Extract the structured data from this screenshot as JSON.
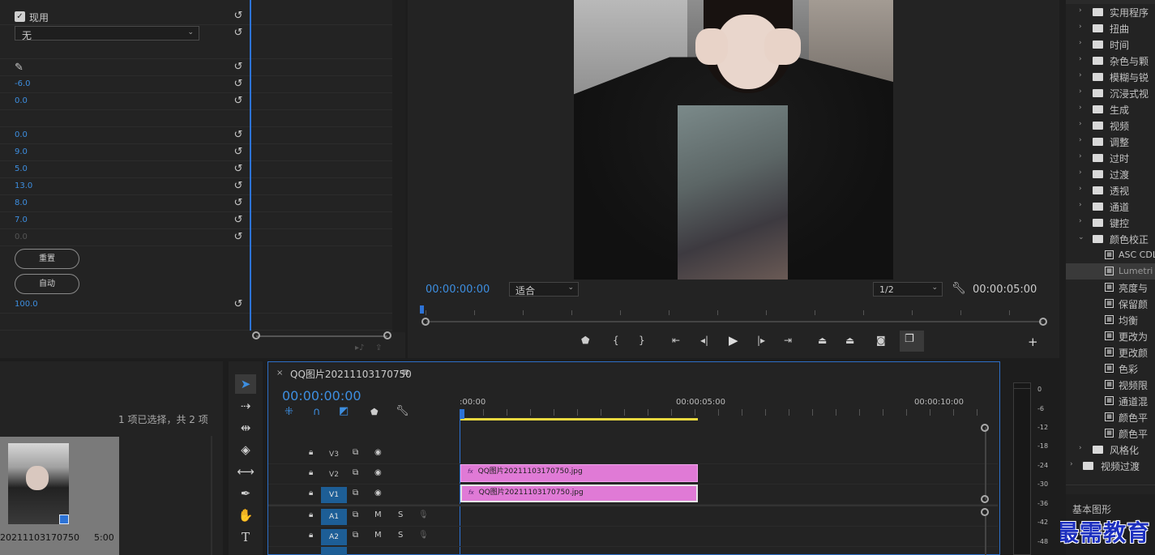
{
  "effect_controls": {
    "checkbox_label": "现用",
    "dropdown_value": "无",
    "values": [
      "-6.0",
      "0.0",
      "0.0",
      "9.0",
      "5.0",
      "13.0",
      "8.0",
      "7.0",
      "0.0"
    ],
    "reset_button": "重置",
    "auto_button": "自动",
    "bottom_value": "100.0"
  },
  "program_monitor": {
    "timecode_current": "00:00:00:00",
    "fit_dropdown": "适合",
    "resolution_dropdown": "1/2",
    "timecode_duration": "00:00:05:00"
  },
  "effects_browser": {
    "folders": [
      "实用程序",
      "扭曲",
      "时间",
      "杂色与颗",
      "模糊与锐",
      "沉浸式视",
      "生成",
      "视频",
      "调整",
      "过时",
      "过渡",
      "透视",
      "通道",
      "键控",
      "颜色校正"
    ],
    "color_correction_items": [
      "ASC CDL",
      "Lumetri",
      "亮度与",
      "保留颜",
      "均衡",
      "更改为",
      "更改颜",
      "色彩",
      "视频限",
      "通道混",
      "颜色平",
      "颜色平"
    ],
    "bottom_folders": [
      "风格化",
      "视频过渡"
    ],
    "section_label": "基本图形",
    "watermark": "最需教育"
  },
  "project_panel": {
    "selection_status": "1 项已选择，共 2 项",
    "thumbnail_name": "20211103170750",
    "thumbnail_duration": "5:00"
  },
  "timeline": {
    "sequence_tab": "QQ图片20211103170750",
    "timecode": "00:00:00:00",
    "ruler": [
      ":00:00",
      "00:00:05:00",
      "00:00:10:00"
    ],
    "tracks": [
      {
        "label": "V3",
        "type": "video",
        "targeted": false
      },
      {
        "label": "V2",
        "type": "video",
        "targeted": false
      },
      {
        "label": "V1",
        "type": "video",
        "targeted": true
      },
      {
        "label": "A1",
        "type": "audio",
        "targeted": true
      },
      {
        "label": "A2",
        "type": "audio",
        "targeted": true
      }
    ],
    "clip_name_v2": "QQ图片20211103170750.jpg",
    "clip_name_v1": "QQ图片20211103170750.jpg",
    "mute": "M",
    "solo": "S"
  },
  "audio_meter": {
    "scale": [
      "0",
      "-6",
      "-12",
      "-18",
      "-24",
      "-30",
      "-36",
      "-42",
      "-48"
    ]
  }
}
